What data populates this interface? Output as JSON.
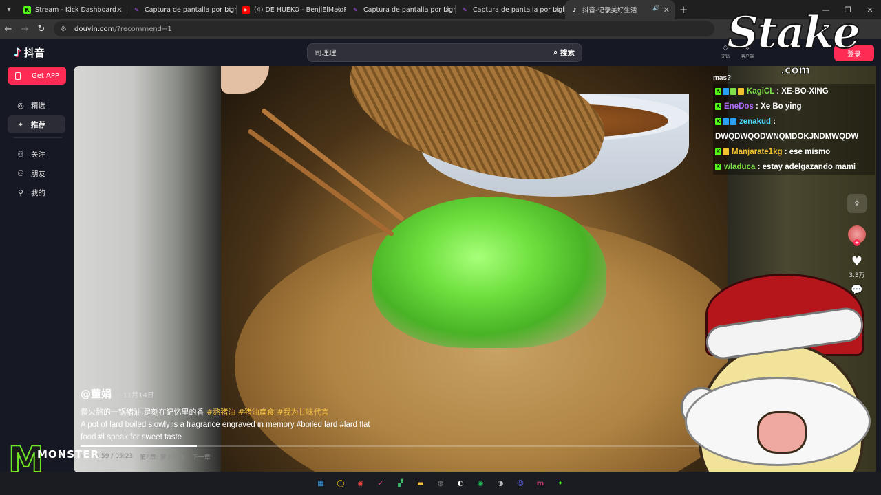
{
  "browser": {
    "tabs": [
      {
        "title": "Stream - Kick Dashboard",
        "icon": "K",
        "icon_color": "#53fc18",
        "active": false
      },
      {
        "title": "Captura de pantalla por Lightsh",
        "icon": "pen",
        "icon_color": "#b259ff",
        "active": false
      },
      {
        "title": "(4) DE HUEKO - BenjiElMaloPalla",
        "icon": "yt",
        "icon_color": "#ff0000",
        "active": false
      },
      {
        "title": "Captura de pantalla por Lightsh",
        "icon": "pen",
        "icon_color": "#b259ff",
        "active": false
      },
      {
        "title": "Captura de pantalla por Lightsh",
        "icon": "pen",
        "icon_color": "#b259ff",
        "active": false
      },
      {
        "title": "抖音-记录美好生活",
        "icon": "tiktok",
        "icon_color": "#ffffff",
        "active": true
      }
    ],
    "url_host": "douyin.com",
    "url_path": "/?recommend=1"
  },
  "douyin": {
    "logo_text": "抖音",
    "search_value": "司理理",
    "search_button": "搜索",
    "top_icons": [
      "充钻",
      "客户端",
      "通知",
      "私信"
    ],
    "login_label": "登录",
    "get_app_label": "Get APP",
    "nav": [
      {
        "label": "精选",
        "icon": "featured-icon"
      },
      {
        "label": "推荐",
        "icon": "recommend-icon",
        "active": true
      },
      {
        "label": "关注",
        "icon": "follow-icon"
      },
      {
        "label": "朋友",
        "icon": "friends-icon"
      },
      {
        "label": "我的",
        "icon": "me-icon"
      }
    ]
  },
  "video": {
    "author": "@董娟",
    "date": "· 11月14日",
    "description_prefix": "慢火熬的一锅猪油,是刻在记忆里的香 ",
    "tags": [
      "#熬猪油",
      "#猪油扁食",
      "#我为甘味代言"
    ],
    "description_en": "A pot of lard boiled slowly is a fragrance engraved in memory #boiled lard #lard flat food #I speak for sweet taste",
    "time_current": "00:59",
    "time_total": "05:23",
    "chapter": "第6章: 萝卜焯水",
    "next_label": "下一章",
    "progress_fraction": 0.18,
    "likes": "3.3万"
  },
  "chat": {
    "top_partial": "mas?",
    "messages": [
      {
        "user": "KagiCL",
        "color": "#7de04a",
        "text": "XE-BO-XING",
        "badges": [
          "k",
          "b1",
          "b3",
          "b2"
        ]
      },
      {
        "user": "EneDos",
        "color": "#b36cff",
        "text": "Xe Bo ying",
        "badges": [
          "k"
        ]
      },
      {
        "user": "zenakud",
        "color": "#4ad8ff",
        "text": "DWQDWQODWNQMDOKJNDMWQDW",
        "badges": [
          "k",
          "b1",
          "b1"
        ]
      },
      {
        "user": "Manjarate1kg",
        "color": "#f2c230",
        "text": "ese mismo",
        "badges": [
          "k",
          "b2"
        ]
      },
      {
        "user": "wladuca",
        "color": "#7de04a",
        "text": "estay adelgazando mami",
        "badges": [
          "k"
        ]
      }
    ]
  },
  "overlay": {
    "stake_logo": "Stake",
    "stake_sub": ".com",
    "monster_text": "MONSTER"
  },
  "taskbar": {
    "apps": [
      "windows-start-icon",
      "norton-icon",
      "chrome-icon",
      "kick-icon",
      "app-icon",
      "files-icon",
      "obs-icon",
      "capcut-icon",
      "spotify-icon",
      "steam-icon",
      "discord-icon",
      "lightshot-icon",
      "kick-green-icon"
    ]
  }
}
